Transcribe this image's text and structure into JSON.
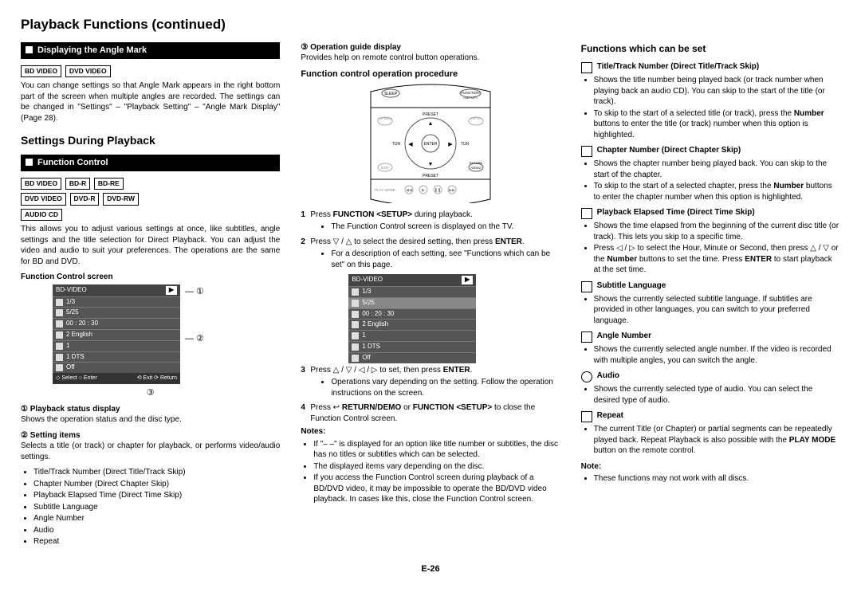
{
  "pageTitle": "Playback Functions (continued)",
  "section1": {
    "bar": "Displaying the Angle Mark",
    "labels": [
      "BD VIDEO",
      "DVD VIDEO"
    ],
    "text": "You can change settings so that Angle Mark appears in the right bottom part of the screen when multiple angles are recorded. The settings can be changed in \"Settings\" – \"Playback Setting\" – \"Angle Mark Display\" (Page 28)."
  },
  "settingsHeading": "Settings During Playback",
  "section2": {
    "bar": "Function Control",
    "labels1": [
      "BD VIDEO",
      "BD-R",
      "BD-RE"
    ],
    "labels2": [
      "DVD VIDEO",
      "DVD-R",
      "DVD-RW"
    ],
    "labels3": [
      "AUDIO CD"
    ],
    "text": "This allows you to adjust various settings at once, like subtitles, angle settings and the title selection for Direct Playback. You can adjust the video and audio to suit your preferences. The operations are the same for BD and DVD.",
    "screenTitle": "Function Control screen",
    "screenRows": {
      "disc": "BD-VIDEO",
      "t1": "1/3",
      "t2": "5/25",
      "t3": "00 : 20 : 30",
      "t4": "2 English",
      "t5": "1",
      "t6": "1 DTS",
      "t7": "Off",
      "f1": "Select",
      "f2": "Enter",
      "f3": "Exit",
      "f4": "Return"
    },
    "c1t": "① Playback status display",
    "c1b": "Shows the operation status and the disc type.",
    "c2t": "② Setting items",
    "c2b": "Selects a title (or track) or chapter for playback, or performs video/audio settings.",
    "listItems": [
      "Title/Track Number (Direct Title/Track Skip)",
      "Chapter Number (Direct Chapter Skip)",
      "Playback Elapsed Time (Direct Time Skip)",
      "Subtitle Language",
      "Angle Number",
      "Audio",
      "Repeat"
    ]
  },
  "col2": {
    "c3t": "③ Operation guide display",
    "c3b": "Provides help on remote control button operations.",
    "procTitle": "Function control operation procedure",
    "step1a": "Press ",
    "step1b": "FUNCTION <SETUP>",
    "step1c": " during playback.",
    "step1bullet": "The Function Control screen is displayed on the TV.",
    "step2a": "Press ▽ / △ to select the desired setting, then press ",
    "step2b": "ENTER",
    "step2c": ".",
    "step2bullet": "For a description of each setting, see \"Functions which can be set\" on this page.",
    "step3a": "Press △ / ▽ / ◁ / ▷ to set, then press ",
    "step3b": "ENTER",
    "step3c": ".",
    "step3bullet": "Operations vary depending on the setting. Follow the operation instructions on the screen.",
    "step4a": "Press ",
    "step4b": "RETURN/DEMO",
    "step4c": " or ",
    "step4d": "FUNCTION <SETUP>",
    "step4e": " to close the Function Control screen.",
    "notesTitle": "Notes:",
    "note1": "If \"– –\" is displayed for an option like title number or subtitles, the disc has no titles or subtitles which can be selected.",
    "note2": "The displayed items vary depending on the disc.",
    "note3": "If you access the Function Control screen during playback of a BD/DVD video, it may be impossible to operate the BD/DVD video playback. In cases like this, close the Function Control screen."
  },
  "col3": {
    "heading": "Functions which can be set",
    "items": [
      {
        "title": "Title/Track Number (Direct Title/Track Skip)",
        "icon": "box",
        "b1": "Shows the title number being played back (or track number when playing back an audio CD). You can skip to the start of the title (or track).",
        "b2a": "To skip to the start of a selected title (or track), press the ",
        "b2b": "Number",
        "b2c": " buttons to enter the title (or track) number when this option is highlighted."
      },
      {
        "title": "Chapter Number (Direct Chapter Skip)",
        "icon": "box",
        "b1": "Shows the chapter number being played back. You can skip to the start of the chapter.",
        "b2a": "To skip to the start of a selected chapter, press the ",
        "b2b": "Number",
        "b2c": " buttons to enter the chapter number when this option is highlighted."
      },
      {
        "title": "Playback Elapsed Time (Direct Time Skip)",
        "icon": "box",
        "b1": "Shows the time elapsed from the beginning of the current disc title (or track). This lets you skip to a specific time.",
        "b2a": "Press ◁ / ▷ to select the Hour, Minute or Second, then press △ / ▽ or the ",
        "b2b": "Number",
        "b2c": " buttons to set the time. Press ",
        "b2d": "ENTER",
        "b2e": " to start playback at the set time."
      },
      {
        "title": "Subtitle Language",
        "icon": "box",
        "b1": "Shows the currently selected subtitle language. If subtitles are provided in other languages, you can switch to your preferred language."
      },
      {
        "title": "Angle Number",
        "icon": "box",
        "b1": "Shows the currently selected angle number. If the video is recorded with multiple angles, you can switch the angle."
      },
      {
        "title": "Audio",
        "icon": "circle",
        "b1": "Shows the currently selected type of audio. You can select the desired type of audio."
      },
      {
        "title": "Repeat",
        "icon": "box",
        "b1a": "The current Title (or Chapter) or partial segments can be repeatedly played back. Repeat Playback is also possible with the ",
        "b1b": "PLAY MODE",
        "b1c": " button on the remote control."
      }
    ],
    "noteTitle": "Note:",
    "noteBody": "These functions may not work with all discs."
  },
  "pageNumber": "E-26"
}
